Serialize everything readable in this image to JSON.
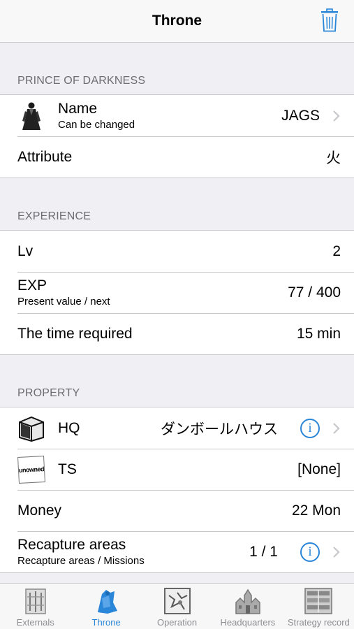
{
  "nav": {
    "title": "Throne"
  },
  "sections": {
    "prince": {
      "header": "PRINCE OF DARKNESS"
    },
    "experience": {
      "header": "EXPERIENCE"
    },
    "property": {
      "header": "PROPERTY"
    }
  },
  "prince": {
    "name": {
      "title": "Name",
      "subtitle": "Can be changed",
      "value": "JAGS"
    },
    "attribute": {
      "title": "Attribute",
      "value": "火"
    }
  },
  "experience": {
    "lv": {
      "title": "Lv",
      "value": "2"
    },
    "exp": {
      "title": "EXP",
      "subtitle": "Present value / next",
      "value": "77 / 400"
    },
    "time": {
      "title": "The time required",
      "value": "15 min"
    }
  },
  "property": {
    "hq": {
      "title": "HQ",
      "value": "ダンボールハウス"
    },
    "ts": {
      "title": "TS",
      "value": "[None]",
      "thumb_text": "unowned"
    },
    "money": {
      "title": "Money",
      "value": "22 Mon"
    },
    "recapture": {
      "title": "Recapture areas",
      "subtitle": "Recapture areas / Missions",
      "value": "1 / 1"
    }
  },
  "tabs": [
    {
      "label": "Externals",
      "icon": "externals-icon"
    },
    {
      "label": "Throne",
      "icon": "throne-icon"
    },
    {
      "label": "Operation",
      "icon": "operation-icon"
    },
    {
      "label": "Headquarters",
      "icon": "headquarters-icon"
    },
    {
      "label": "Strategy record",
      "icon": "strategy-record-icon"
    }
  ],
  "colors": {
    "accent": "#2a86d8",
    "separator": "#c8c7cc",
    "background": "#efeff4",
    "tab_inactive": "#8e8e93"
  }
}
